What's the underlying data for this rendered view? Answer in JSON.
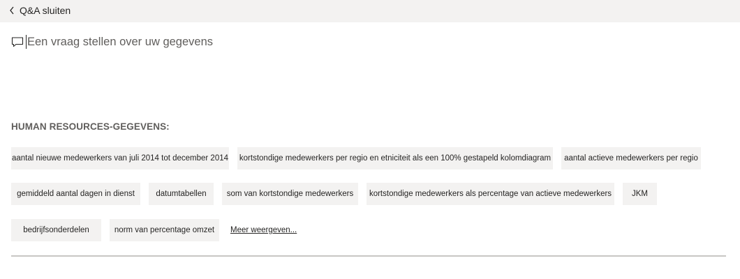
{
  "header": {
    "close_label": "Q&A sluiten"
  },
  "question": {
    "placeholder": "Een vraag stellen over uw gegevens"
  },
  "suggestions": {
    "heading": "HUMAN RESOURCES-GEGEVENS:",
    "rows": [
      [
        "aantal nieuwe medewerkers van juli 2014 tot december 2014",
        "kortstondige medewerkers per regio en etniciteit als een 100% gestapeld kolomdiagram",
        "aantal actieve medewerkers per regio"
      ],
      [
        "gemiddeld aantal dagen in dienst",
        "datumtabellen",
        "som van kortstondige medewerkers",
        "kortstondige medewerkers als percentage van actieve medewerkers",
        "JKM"
      ],
      [
        "bedrijfsonderdelen",
        "norm van percentage omzet"
      ]
    ],
    "more_label": "Meer weergeven..."
  }
}
